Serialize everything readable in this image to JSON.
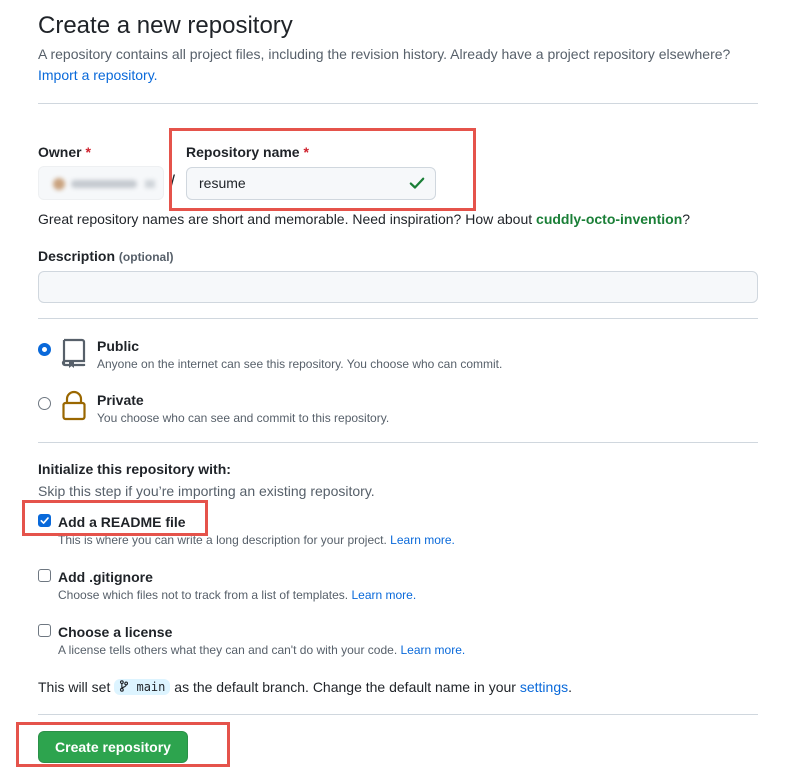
{
  "header": {
    "title": "Create a new repository",
    "subtitle_text": "A repository contains all project files, including the revision history. Already have a project repository elsewhere?",
    "import_link": "Import a repository."
  },
  "owner": {
    "label": "Owner",
    "required_mark": "*"
  },
  "repository": {
    "label": "Repository name",
    "required_mark": "*",
    "separator": "/",
    "value": "resume",
    "valid": true
  },
  "name_hint": {
    "text": "Great repository names are short and memorable. Need inspiration? How about",
    "suggestion": "cuddly-octo-invention",
    "end": "?"
  },
  "description": {
    "label": "Description",
    "optional": "(optional)",
    "value": ""
  },
  "visibility": {
    "selected": "public",
    "options": [
      {
        "title": "Public",
        "desc": "Anyone on the internet can see this repository. You choose who can commit.",
        "icon": "repo-book-icon"
      },
      {
        "title": "Private",
        "desc": "You choose who can see and commit to this repository.",
        "icon": "lock-icon"
      }
    ]
  },
  "initialize": {
    "heading": "Initialize this repository with:",
    "subheading": "Skip this step if you’re importing an existing repository.",
    "options": [
      {
        "title": "Add a README file",
        "desc": "This is where you can write a long description for your project.",
        "link": "Learn more.",
        "checked": true
      },
      {
        "title": "Add .gitignore",
        "desc": "Choose which files not to track from a list of templates.",
        "link": "Learn more.",
        "checked": false
      },
      {
        "title": "Choose a license",
        "desc": "A license tells others what they can and can't do with your code.",
        "link": "Learn more.",
        "checked": false
      }
    ]
  },
  "branch_note": {
    "prefix": "This will set",
    "branch": "main",
    "middle": "as the default branch. Change the default name in your",
    "link": "settings",
    "end": "."
  },
  "submit": {
    "label": "Create repository"
  },
  "colors": {
    "accent": "#0969da",
    "success": "#2da44e",
    "highlight_box": "#e5534b"
  }
}
